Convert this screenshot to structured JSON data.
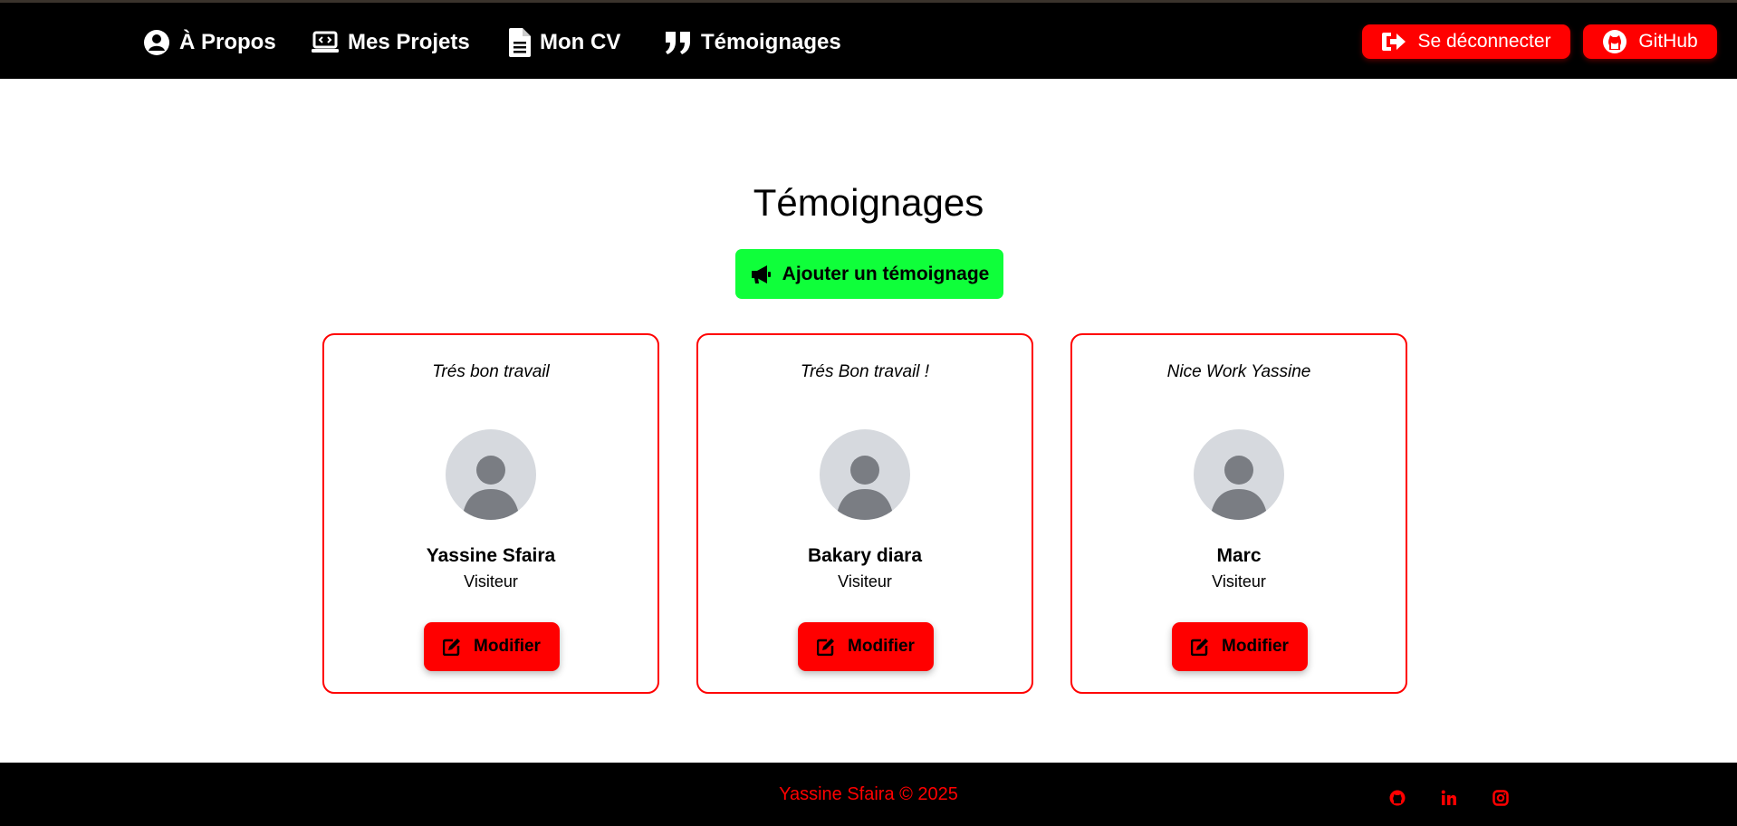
{
  "colors": {
    "navbar": "#000000",
    "accent": "#ff0000",
    "add_button": "#0fff3a",
    "avatar_bg": "#d6d9de",
    "avatar_fg": "#7a7d83"
  },
  "nav": {
    "items": [
      {
        "label": "À Propos",
        "icon": "user-circle-icon"
      },
      {
        "label": "Mes Projets",
        "icon": "laptop-code-icon"
      },
      {
        "label": "Mon CV",
        "icon": "file-icon"
      },
      {
        "label": "Témoignages",
        "icon": "quote-icon"
      }
    ],
    "logout_label": "Se déconnecter",
    "github_label": "GitHub"
  },
  "main": {
    "title": "Témoignages",
    "add_label": "Ajouter un témoignage",
    "cards": [
      {
        "quote": "Trés bon travail",
        "name": "Yassine Sfaira",
        "role": "Visiteur",
        "edit_label": "Modifier"
      },
      {
        "quote": "Trés Bon travail !",
        "name": "Bakary diara",
        "role": "Visiteur",
        "edit_label": "Modifier"
      },
      {
        "quote": "Nice Work Yassine",
        "name": "Marc",
        "role": "Visiteur",
        "edit_label": "Modifier"
      }
    ]
  },
  "footer": {
    "copyright": "Yassine Sfaira © 2025",
    "socials": [
      "github-icon",
      "linkedin-icon",
      "instagram-icon"
    ]
  }
}
